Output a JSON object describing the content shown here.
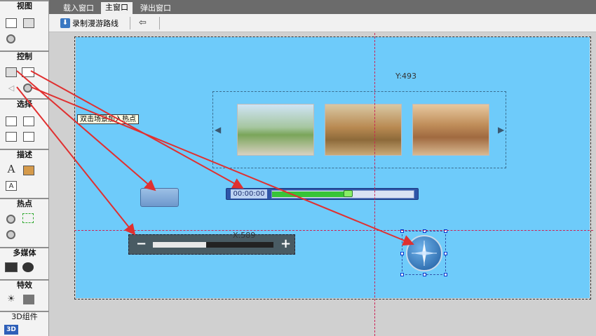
{
  "sidebar": {
    "sections": [
      {
        "title": "视图"
      },
      {
        "title": "控制"
      },
      {
        "title": "选择"
      },
      {
        "title": "描述"
      },
      {
        "title": "热点"
      },
      {
        "title": "多媒体"
      },
      {
        "title": "特效"
      },
      {
        "title": "3D组件"
      }
    ],
    "icons": {
      "describe_text": "A",
      "describe_textbox": "A",
      "three_d": "3D"
    }
  },
  "tabs": [
    "载入窗口",
    "主窗口",
    "弹出窗口"
  ],
  "active_tab": "主窗口",
  "toolbar": {
    "record_label": "录制漫游路线",
    "back_icon": "arrow-left-icon"
  },
  "guides": {
    "y_label": "Y:493",
    "x_label": "X:589"
  },
  "tooltip": "双击场景加入热点",
  "player": {
    "time": "00:00:00",
    "progress": 0.54
  },
  "zoom": {
    "minus": "−",
    "plus": "+",
    "level": 0.44
  },
  "colors": {
    "stage": "#6ecbfa",
    "guide": "#cc2255",
    "arrow": "#e03030"
  }
}
